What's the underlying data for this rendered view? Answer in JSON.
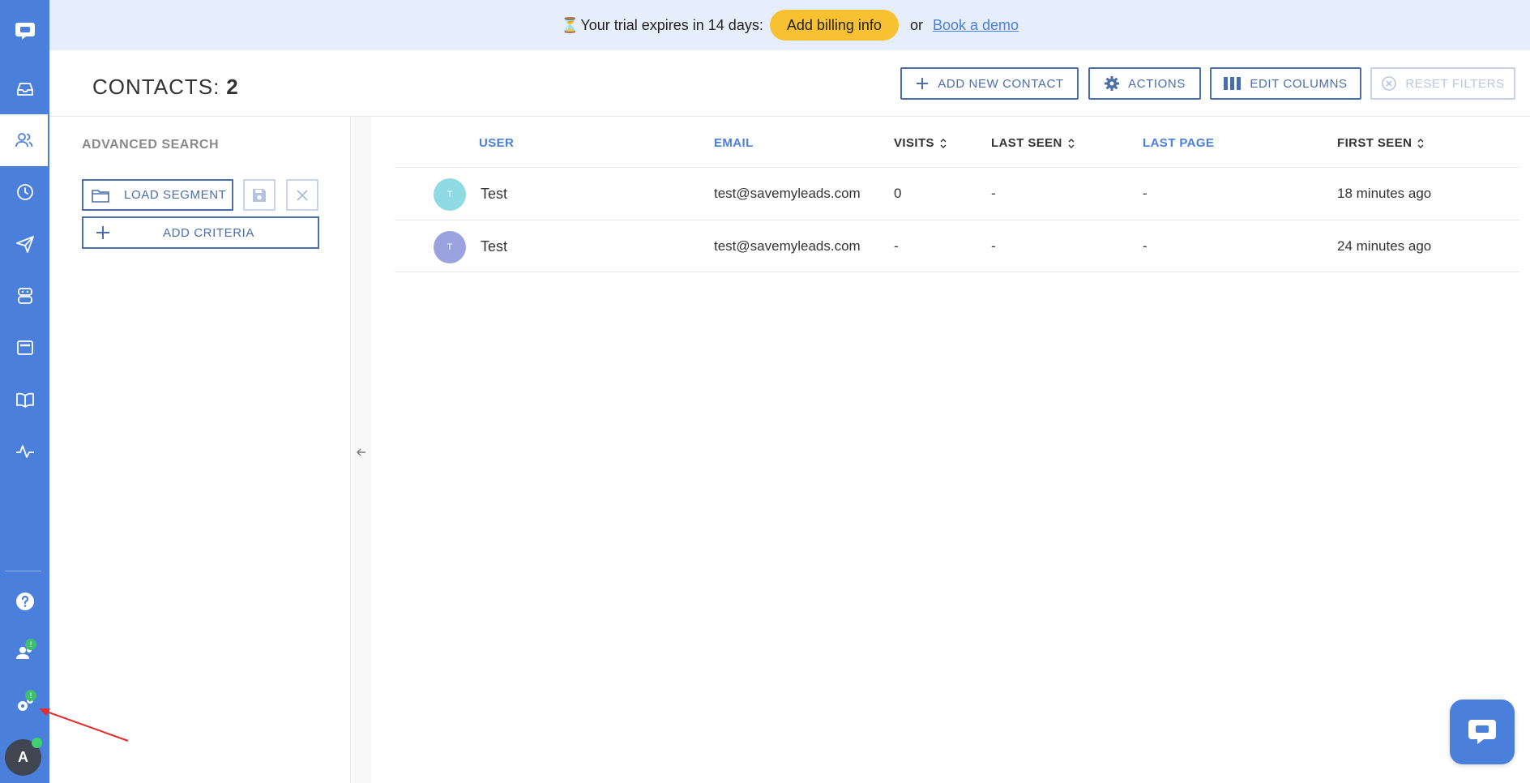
{
  "colors": {
    "brand": "#4b7fdc",
    "trial_bg": "#e6eefb",
    "billing_btn": "#f7c131",
    "badge_green": "#3fbf6f",
    "button_border": "#4b6ea8"
  },
  "sidebar": {
    "items": [
      {
        "icon": "chat-logo-icon"
      },
      {
        "icon": "inbox-icon"
      },
      {
        "icon": "contacts-icon",
        "active": true
      },
      {
        "icon": "clock-icon"
      },
      {
        "icon": "send-icon"
      },
      {
        "icon": "bot-icon"
      },
      {
        "icon": "card-icon"
      },
      {
        "icon": "book-icon"
      },
      {
        "icon": "activity-icon"
      }
    ],
    "bottom": {
      "help_icon": "help-icon",
      "team_badge": "!",
      "settings_badge": "!",
      "avatar_letter": "A"
    }
  },
  "trial": {
    "hourglass": "⏳",
    "message": "Your trial expires in 14 days:",
    "billing_label": "Add billing info",
    "or_text": "or",
    "demo_label": "Book a demo"
  },
  "header": {
    "title": "CONTACTS:",
    "count": "2",
    "add_contact_label": "ADD NEW CONTACT",
    "actions_label": "ACTIONS",
    "edit_columns_label": "EDIT COLUMNS",
    "reset_filters_label": "RESET FILTERS"
  },
  "search": {
    "title": "ADVANCED SEARCH",
    "load_segment_label": "LOAD SEGMENT",
    "add_criteria_label": "ADD CRITERIA"
  },
  "table": {
    "columns": {
      "user": "USER",
      "email": "EMAIL",
      "visits": "VISITS",
      "last_seen": "LAST SEEN",
      "last_page": "LAST PAGE",
      "first_seen": "FIRST SEEN"
    },
    "rows": [
      {
        "initial": "T",
        "avatar_color": "#8fdbe3",
        "name": "Test",
        "email": "test@savemyleads.com",
        "visits": "0",
        "last_seen": "-",
        "last_page": "-",
        "first_seen": "18 minutes ago"
      },
      {
        "initial": "T",
        "avatar_color": "#9aa3e0",
        "name": "Test",
        "email": "test@savemyleads.com",
        "visits": "-",
        "last_seen": "-",
        "last_page": "-",
        "first_seen": "24 minutes ago"
      }
    ]
  }
}
